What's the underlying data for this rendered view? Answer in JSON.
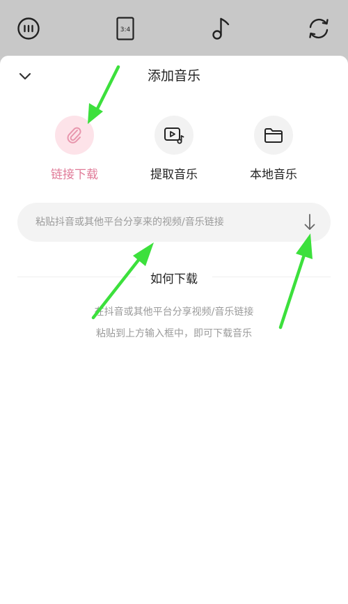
{
  "topbar": {
    "aspect_label": "3:4",
    "icons": [
      "menu-dots-icon",
      "aspect-ratio-icon",
      "music-note-icon",
      "refresh-icon"
    ]
  },
  "sheet": {
    "title": "添加音乐",
    "options": [
      {
        "label": "链接下载",
        "icon": "paperclip-icon",
        "active": true
      },
      {
        "label": "提取音乐",
        "icon": "video-music-icon",
        "active": false
      },
      {
        "label": "本地音乐",
        "icon": "folder-icon",
        "active": false
      }
    ],
    "link_input": {
      "value": "",
      "placeholder": "粘贴抖音或其他平台分享来的视频/音乐链接"
    },
    "howto": {
      "title": "如何下载",
      "lines": [
        "在抖音或其他平台分享视频/音乐链接",
        "粘贴到上方输入框中，即可下载音乐"
      ]
    }
  },
  "colors": {
    "accent": "#e07b98",
    "accent_bg": "#fde3e9",
    "annotation_arrow": "#3ce03c",
    "topbar_bg": "#c8c8c8"
  }
}
